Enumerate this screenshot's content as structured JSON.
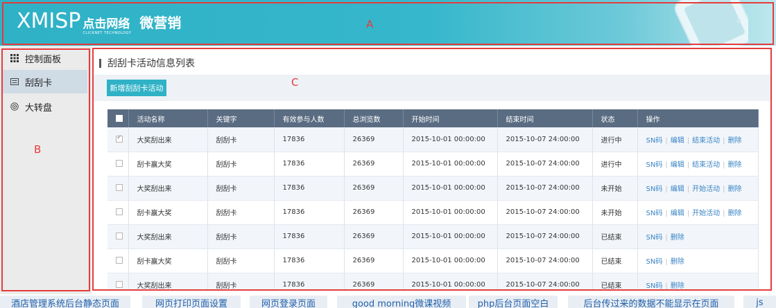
{
  "header": {
    "logo_main": "XMISP",
    "logo_cn": "点击网络",
    "logo_en": "CLICKNET TECHNOLOGY",
    "logo_sub": "微营销"
  },
  "annotations": {
    "a": "A",
    "b": "B",
    "c": "C"
  },
  "sidebar": {
    "items": [
      {
        "label": "控制面板",
        "icon": "grid-icon"
      },
      {
        "label": "刮刮卡",
        "icon": "card-icon"
      },
      {
        "label": "大转盘",
        "icon": "wheel-icon"
      }
    ],
    "active_index": 1
  },
  "main": {
    "title": "刮刮卡活动信息列表",
    "add_button": "新增刮刮卡活动",
    "columns": [
      "活动名称",
      "关键字",
      "有效参与人数",
      "总浏览数",
      "开始时间",
      "结束时间",
      "状态",
      "操作"
    ],
    "rows": [
      {
        "checked": true,
        "name": "大奖刮出来",
        "keyword": "刮刮卡",
        "participants": "17836",
        "views": "26369",
        "start": "2015-10-01  00:00:00",
        "end": "2015-10-07  24:00:00",
        "status": "进行中",
        "ops": [
          "SN码",
          "编辑",
          "结束活动",
          "删除"
        ]
      },
      {
        "checked": false,
        "name": "刮卡赢大奖",
        "keyword": "刮刮卡",
        "participants": "17836",
        "views": "26369",
        "start": "2015-10-01  00:00:00",
        "end": "2015-10-07  24:00:00",
        "status": "进行中",
        "ops": [
          "SN码",
          "编辑",
          "结束活动",
          "删除"
        ]
      },
      {
        "checked": false,
        "name": "大奖刮出来",
        "keyword": "刮刮卡",
        "participants": "17836",
        "views": "26369",
        "start": "2015-10-01  00:00:00",
        "end": "2015-10-07  24:00:00",
        "status": "未开始",
        "ops": [
          "SN码",
          "编辑",
          "开始活动",
          "删除"
        ]
      },
      {
        "checked": false,
        "name": "刮卡赢大奖",
        "keyword": "刮刮卡",
        "participants": "17836",
        "views": "26369",
        "start": "2015-10-01  00:00:00",
        "end": "2015-10-07  24:00:00",
        "status": "未开始",
        "ops": [
          "SN码",
          "编辑",
          "开始活动",
          "删除"
        ]
      },
      {
        "checked": false,
        "name": "大奖刮出来",
        "keyword": "刮刮卡",
        "participants": "17836",
        "views": "26369",
        "start": "2015-10-01  00:00:00",
        "end": "2015-10-07  24:00:00",
        "status": "已结束",
        "ops": [
          "SN码",
          "删除"
        ]
      },
      {
        "checked": false,
        "name": "刮卡赢大奖",
        "keyword": "刮刮卡",
        "participants": "17836",
        "views": "26369",
        "start": "2015-10-01  00:00:00",
        "end": "2015-10-07  24:00:00",
        "status": "已结束",
        "ops": [
          "SN码",
          "删除"
        ]
      },
      {
        "checked": false,
        "name": "大奖刮出来",
        "keyword": "刮刮卡",
        "participants": "17836",
        "views": "26369",
        "start": "2015-10-01  00:00:00",
        "end": "2015-10-07  24:00:00",
        "status": "已结束",
        "ops": [
          "SN码",
          "删除"
        ]
      }
    ]
  },
  "related_links": [
    "酒店管理系统后台静态页面",
    "网页打印页面设置",
    "网页登录页面",
    "good morning微课视频",
    "php后台页面空白",
    "后台传过来的数据不能显示在页面",
    "js"
  ],
  "colors": {
    "brand": "#2fb1c6",
    "table_header": "#5a6c82",
    "annotation": "#e53b3b",
    "link": "#3a84c4"
  }
}
